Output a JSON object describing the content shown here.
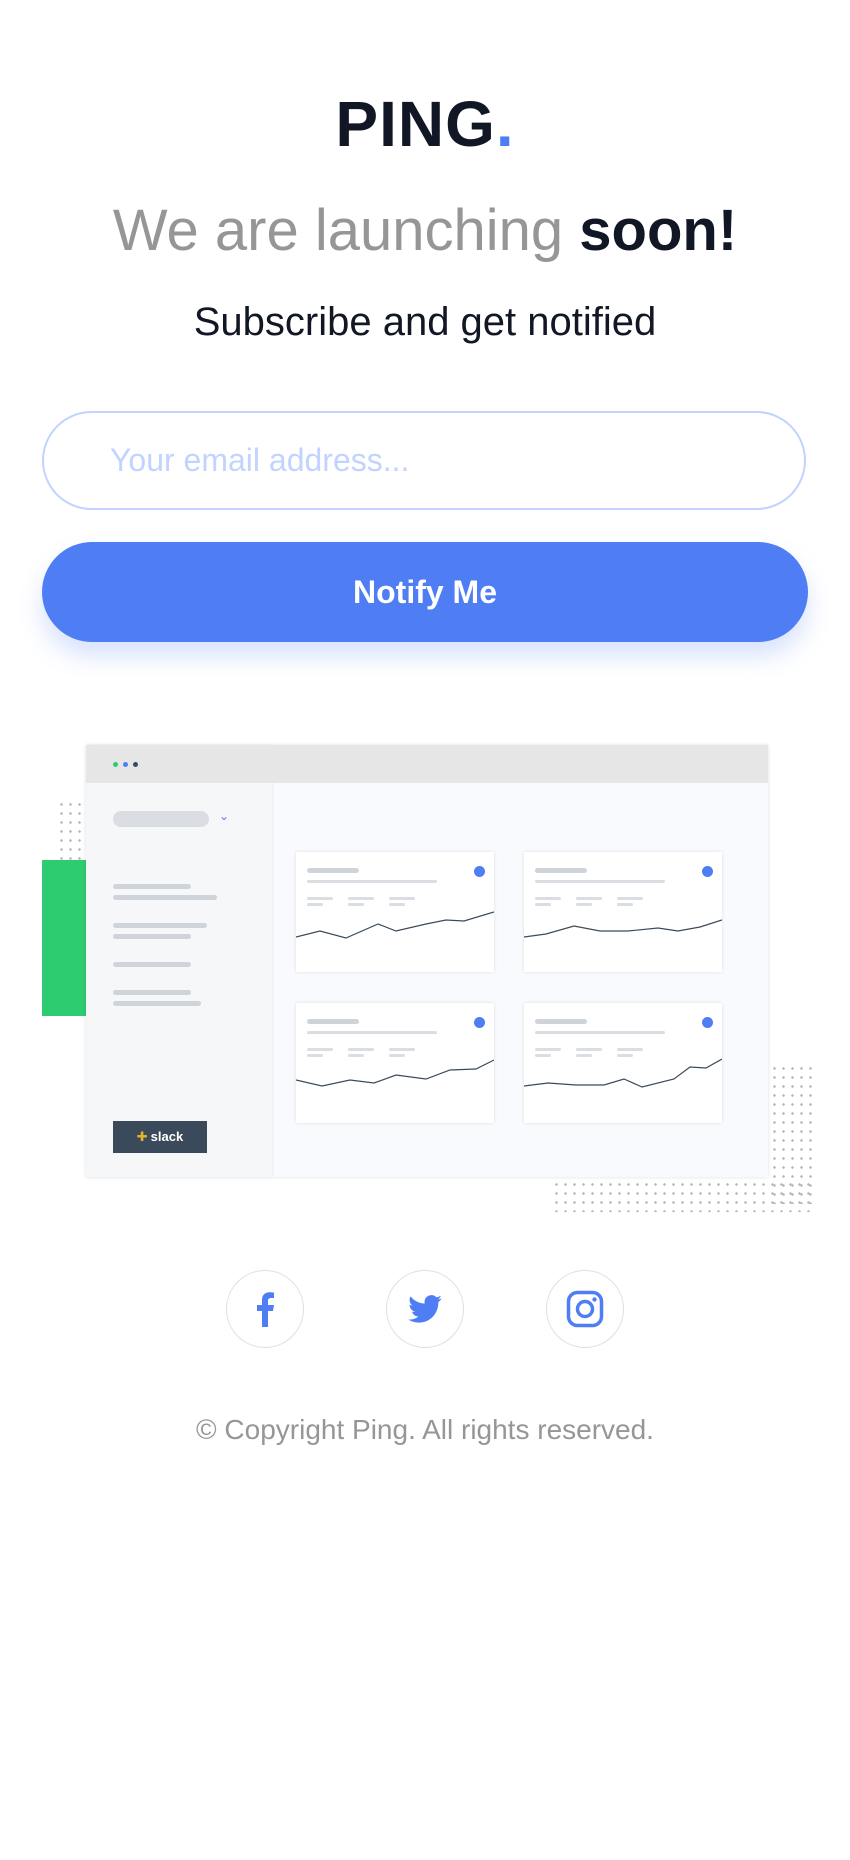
{
  "brand": {
    "name": "PING",
    "dot": ".",
    "accent_color": "#4f7df3"
  },
  "hero": {
    "headline_light": "We are launching ",
    "headline_bold": "soon!",
    "subheadline": "Subscribe and get notified"
  },
  "form": {
    "email_placeholder": "Your email address...",
    "email_value": "",
    "submit_label": "Notify Me"
  },
  "illustration": {
    "sidebar_badge": "slack",
    "cards": 4
  },
  "social": [
    {
      "name": "facebook",
      "icon": "facebook-icon"
    },
    {
      "name": "twitter",
      "icon": "twitter-icon"
    },
    {
      "name": "instagram",
      "icon": "instagram-icon"
    }
  ],
  "footer": {
    "copyright": "© Copyright Ping. All rights reserved."
  },
  "colors": {
    "primary": "#4f7df3",
    "dark": "#121725",
    "gray": "#969696",
    "pale_blue": "#c2d3ff",
    "green": "#2ecc71"
  }
}
